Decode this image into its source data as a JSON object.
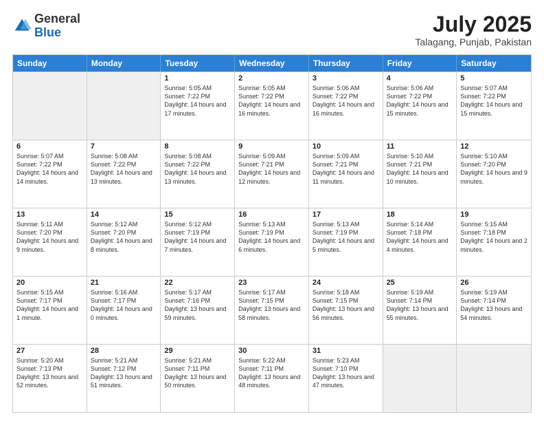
{
  "header": {
    "logo_general": "General",
    "logo_blue": "Blue",
    "month": "July 2025",
    "location": "Talagang, Punjab, Pakistan"
  },
  "days": [
    "Sunday",
    "Monday",
    "Tuesday",
    "Wednesday",
    "Thursday",
    "Friday",
    "Saturday"
  ],
  "weeks": [
    [
      {
        "day": "",
        "sunrise": "",
        "sunset": "",
        "daylight": "",
        "empty": true
      },
      {
        "day": "",
        "sunrise": "",
        "sunset": "",
        "daylight": "",
        "empty": true
      },
      {
        "day": "1",
        "sunrise": "Sunrise: 5:05 AM",
        "sunset": "Sunset: 7:22 PM",
        "daylight": "Daylight: 14 hours and 17 minutes."
      },
      {
        "day": "2",
        "sunrise": "Sunrise: 5:05 AM",
        "sunset": "Sunset: 7:22 PM",
        "daylight": "Daylight: 14 hours and 16 minutes."
      },
      {
        "day": "3",
        "sunrise": "Sunrise: 5:06 AM",
        "sunset": "Sunset: 7:22 PM",
        "daylight": "Daylight: 14 hours and 16 minutes."
      },
      {
        "day": "4",
        "sunrise": "Sunrise: 5:06 AM",
        "sunset": "Sunset: 7:22 PM",
        "daylight": "Daylight: 14 hours and 15 minutes."
      },
      {
        "day": "5",
        "sunrise": "Sunrise: 5:07 AM",
        "sunset": "Sunset: 7:22 PM",
        "daylight": "Daylight: 14 hours and 15 minutes."
      }
    ],
    [
      {
        "day": "6",
        "sunrise": "Sunrise: 5:07 AM",
        "sunset": "Sunset: 7:22 PM",
        "daylight": "Daylight: 14 hours and 14 minutes."
      },
      {
        "day": "7",
        "sunrise": "Sunrise: 5:08 AM",
        "sunset": "Sunset: 7:22 PM",
        "daylight": "Daylight: 14 hours and 13 minutes."
      },
      {
        "day": "8",
        "sunrise": "Sunrise: 5:08 AM",
        "sunset": "Sunset: 7:22 PM",
        "daylight": "Daylight: 14 hours and 13 minutes."
      },
      {
        "day": "9",
        "sunrise": "Sunrise: 5:09 AM",
        "sunset": "Sunset: 7:21 PM",
        "daylight": "Daylight: 14 hours and 12 minutes."
      },
      {
        "day": "10",
        "sunrise": "Sunrise: 5:09 AM",
        "sunset": "Sunset: 7:21 PM",
        "daylight": "Daylight: 14 hours and 11 minutes."
      },
      {
        "day": "11",
        "sunrise": "Sunrise: 5:10 AM",
        "sunset": "Sunset: 7:21 PM",
        "daylight": "Daylight: 14 hours and 10 minutes."
      },
      {
        "day": "12",
        "sunrise": "Sunrise: 5:10 AM",
        "sunset": "Sunset: 7:20 PM",
        "daylight": "Daylight: 14 hours and 9 minutes."
      }
    ],
    [
      {
        "day": "13",
        "sunrise": "Sunrise: 5:11 AM",
        "sunset": "Sunset: 7:20 PM",
        "daylight": "Daylight: 14 hours and 9 minutes."
      },
      {
        "day": "14",
        "sunrise": "Sunrise: 5:12 AM",
        "sunset": "Sunset: 7:20 PM",
        "daylight": "Daylight: 14 hours and 8 minutes."
      },
      {
        "day": "15",
        "sunrise": "Sunrise: 5:12 AM",
        "sunset": "Sunset: 7:19 PM",
        "daylight": "Daylight: 14 hours and 7 minutes."
      },
      {
        "day": "16",
        "sunrise": "Sunrise: 5:13 AM",
        "sunset": "Sunset: 7:19 PM",
        "daylight": "Daylight: 14 hours and 6 minutes."
      },
      {
        "day": "17",
        "sunrise": "Sunrise: 5:13 AM",
        "sunset": "Sunset: 7:19 PM",
        "daylight": "Daylight: 14 hours and 5 minutes."
      },
      {
        "day": "18",
        "sunrise": "Sunrise: 5:14 AM",
        "sunset": "Sunset: 7:18 PM",
        "daylight": "Daylight: 14 hours and 4 minutes."
      },
      {
        "day": "19",
        "sunrise": "Sunrise: 5:15 AM",
        "sunset": "Sunset: 7:18 PM",
        "daylight": "Daylight: 14 hours and 2 minutes."
      }
    ],
    [
      {
        "day": "20",
        "sunrise": "Sunrise: 5:15 AM",
        "sunset": "Sunset: 7:17 PM",
        "daylight": "Daylight: 14 hours and 1 minute."
      },
      {
        "day": "21",
        "sunrise": "Sunrise: 5:16 AM",
        "sunset": "Sunset: 7:17 PM",
        "daylight": "Daylight: 14 hours and 0 minutes."
      },
      {
        "day": "22",
        "sunrise": "Sunrise: 5:17 AM",
        "sunset": "Sunset: 7:16 PM",
        "daylight": "Daylight: 13 hours and 59 minutes."
      },
      {
        "day": "23",
        "sunrise": "Sunrise: 5:17 AM",
        "sunset": "Sunset: 7:15 PM",
        "daylight": "Daylight: 13 hours and 58 minutes."
      },
      {
        "day": "24",
        "sunrise": "Sunrise: 5:18 AM",
        "sunset": "Sunset: 7:15 PM",
        "daylight": "Daylight: 13 hours and 56 minutes."
      },
      {
        "day": "25",
        "sunrise": "Sunrise: 5:19 AM",
        "sunset": "Sunset: 7:14 PM",
        "daylight": "Daylight: 13 hours and 55 minutes."
      },
      {
        "day": "26",
        "sunrise": "Sunrise: 5:19 AM",
        "sunset": "Sunset: 7:14 PM",
        "daylight": "Daylight: 13 hours and 54 minutes."
      }
    ],
    [
      {
        "day": "27",
        "sunrise": "Sunrise: 5:20 AM",
        "sunset": "Sunset: 7:13 PM",
        "daylight": "Daylight: 13 hours and 52 minutes."
      },
      {
        "day": "28",
        "sunrise": "Sunrise: 5:21 AM",
        "sunset": "Sunset: 7:12 PM",
        "daylight": "Daylight: 13 hours and 51 minutes."
      },
      {
        "day": "29",
        "sunrise": "Sunrise: 5:21 AM",
        "sunset": "Sunset: 7:11 PM",
        "daylight": "Daylight: 13 hours and 50 minutes."
      },
      {
        "day": "30",
        "sunrise": "Sunrise: 5:22 AM",
        "sunset": "Sunset: 7:11 PM",
        "daylight": "Daylight: 13 hours and 48 minutes."
      },
      {
        "day": "31",
        "sunrise": "Sunrise: 5:23 AM",
        "sunset": "Sunset: 7:10 PM",
        "daylight": "Daylight: 13 hours and 47 minutes."
      },
      {
        "day": "",
        "sunrise": "",
        "sunset": "",
        "daylight": "",
        "empty": true
      },
      {
        "day": "",
        "sunrise": "",
        "sunset": "",
        "daylight": "",
        "empty": true
      }
    ]
  ]
}
